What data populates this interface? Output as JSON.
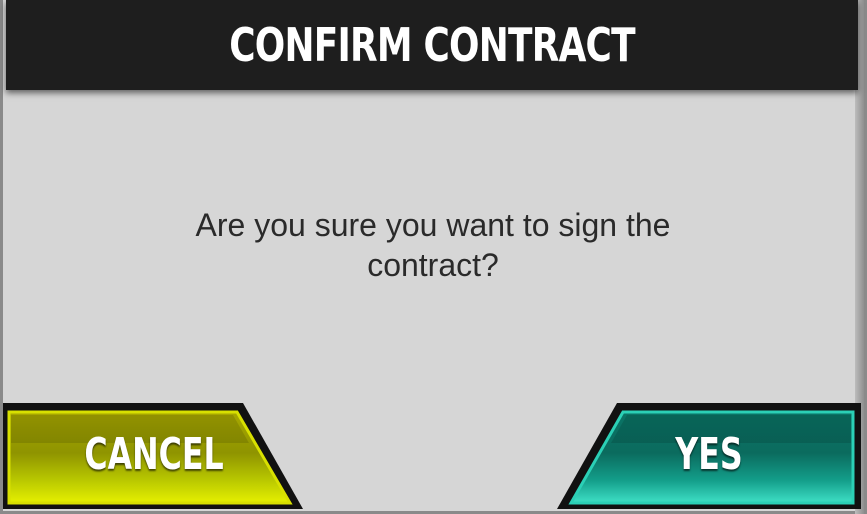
{
  "dialog": {
    "title": "CONFIRM CONTRACT",
    "message": "Are you sure you want to sign the contract?"
  },
  "buttons": {
    "cancel_label": "CANCEL",
    "yes_label": "YES"
  },
  "colors": {
    "header_bg": "#1e1e1e",
    "dialog_bg": "#d6d6d6",
    "cancel_accent": "#b8c400",
    "yes_accent": "#0e9a86"
  }
}
